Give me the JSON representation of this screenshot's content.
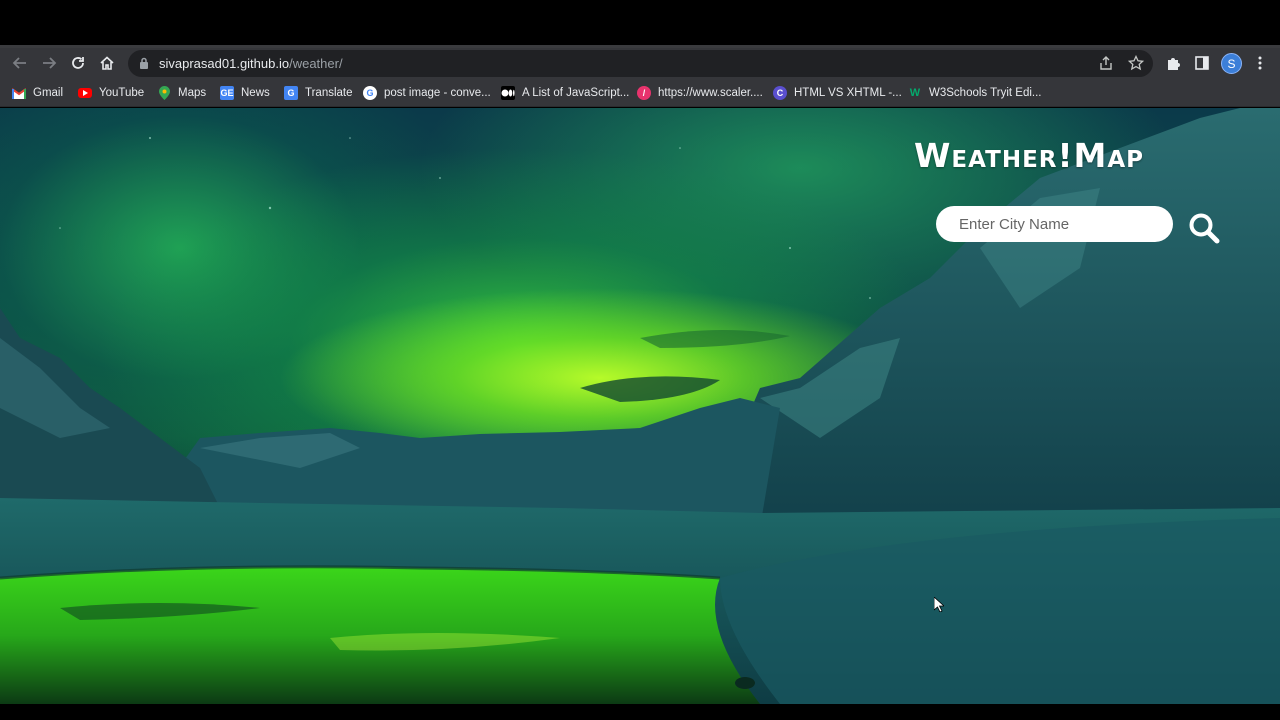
{
  "browser": {
    "url_host": "sivaprasad01.github.io",
    "url_path": "/weather/",
    "profile_initial": "S"
  },
  "bookmarks": [
    {
      "label": "Gmail",
      "icon": "gmail-icon",
      "color": "#ea4335"
    },
    {
      "label": "YouTube",
      "icon": "youtube-icon",
      "color": "#ff0000"
    },
    {
      "label": "Maps",
      "icon": "maps-icon",
      "color": "#34a853"
    },
    {
      "label": "News",
      "icon": "news-icon",
      "color": "#4285f4"
    },
    {
      "label": "Translate",
      "icon": "translate-icon",
      "color": "#4285f4"
    },
    {
      "label": "post image - conve...",
      "icon": "google-icon",
      "color": "#ffffff"
    },
    {
      "label": "A List of JavaScript...",
      "icon": "medium-icon",
      "color": "#000000"
    },
    {
      "label": "https://www.scaler....",
      "icon": "scaler-icon",
      "color": "#e8336d"
    },
    {
      "label": "HTML VS XHTML -...",
      "icon": "c-icon",
      "color": "#5a4fcf"
    },
    {
      "label": "W3Schools Tryit Edi...",
      "icon": "w3schools-icon",
      "color": "#04aa6d"
    }
  ],
  "app": {
    "logo": "Weather!Map",
    "search_placeholder": "Enter City Name"
  }
}
